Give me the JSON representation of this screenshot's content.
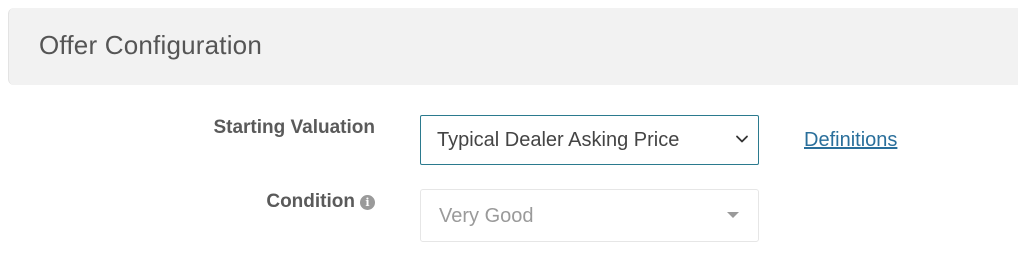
{
  "section": {
    "title": "Offer Configuration"
  },
  "form": {
    "starting_valuation": {
      "label": "Starting Valuation",
      "selected": "Typical Dealer Asking Price",
      "icon": "chevron-down-icon",
      "link_label": "Definitions"
    },
    "condition": {
      "label": "Condition",
      "info_icon": "info-icon",
      "info_glyph": "i",
      "selected": "Very Good",
      "icon": "caret-down-icon"
    }
  },
  "colors": {
    "header_bg": "#f2f2f2",
    "link": "#2a6f9b",
    "focus_border": "#2b7a8e"
  }
}
